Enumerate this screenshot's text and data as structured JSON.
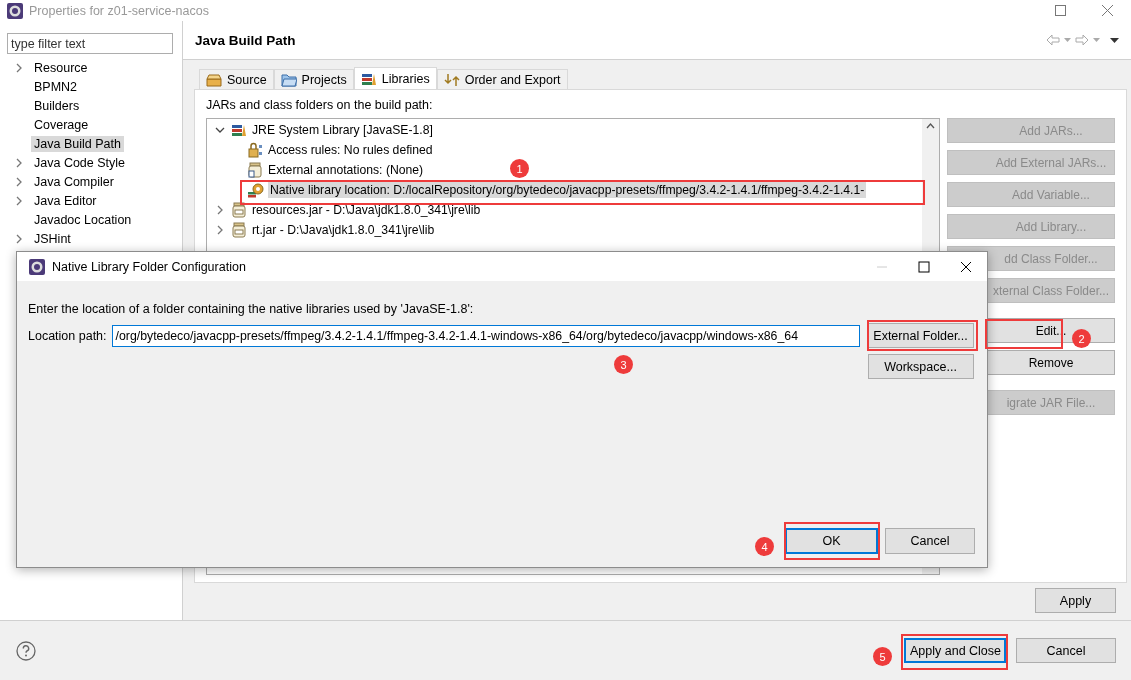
{
  "window": {
    "title": "Properties for z01-service-nacos"
  },
  "filter": {
    "placeholder": "type filter text"
  },
  "sidebar": {
    "items": [
      {
        "label": "Resource",
        "expandable": true,
        "selected": false
      },
      {
        "label": "BPMN2",
        "expandable": false,
        "selected": false
      },
      {
        "label": "Builders",
        "expandable": false,
        "selected": false
      },
      {
        "label": "Coverage",
        "expandable": false,
        "selected": false
      },
      {
        "label": "Java Build Path",
        "expandable": false,
        "selected": true
      },
      {
        "label": "Java Code Style",
        "expandable": true,
        "selected": false
      },
      {
        "label": "Java Compiler",
        "expandable": true,
        "selected": false
      },
      {
        "label": "Java Editor",
        "expandable": true,
        "selected": false
      },
      {
        "label": "Javadoc Location",
        "expandable": false,
        "selected": false
      },
      {
        "label": "JSHint",
        "expandable": true,
        "selected": false
      }
    ]
  },
  "page": {
    "title": "Java Build Path"
  },
  "tabs": [
    {
      "label": "Source",
      "kind": "source",
      "selected": false
    },
    {
      "label": "Projects",
      "kind": "projects",
      "selected": false
    },
    {
      "label": "Libraries",
      "kind": "libraries",
      "selected": true
    },
    {
      "label": "Order and Export",
      "kind": "order",
      "selected": false
    }
  ],
  "libraries": {
    "label": "JARs and class folders on the build path:",
    "tree": [
      {
        "label": "JRE System Library [JavaSE-1.8]",
        "kind": "library",
        "expanded": true,
        "selected": false,
        "children": [
          {
            "label": "Access rules: No rules defined",
            "kind": "rules",
            "selected": false
          },
          {
            "label": "External annotations: (None)",
            "kind": "annotations",
            "selected": false
          },
          {
            "label": "Native library location: D:/localRepository/org/bytedeco/javacpp-presets/ffmpeg/3.4.2-1.4.1/ffmpeg-3.4.2-1.4.1-",
            "kind": "native",
            "selected": true
          }
        ]
      },
      {
        "label": "resources.jar - D:\\Java\\jdk1.8.0_341\\jre\\lib",
        "kind": "jar",
        "expanded": false,
        "selected": false
      },
      {
        "label": "rt.jar - D:\\Java\\jdk1.8.0_341\\jre\\lib",
        "kind": "jar",
        "expanded": false,
        "selected": false
      }
    ],
    "buttons": [
      {
        "label": "Add JARs...",
        "disabled": true,
        "separated": false
      },
      {
        "label": "Add External JARs...",
        "disabled": true,
        "separated": false
      },
      {
        "label": "Add Variable...",
        "disabled": true,
        "separated": false
      },
      {
        "label": "Add Library...",
        "disabled": true,
        "separated": false
      },
      {
        "label": "dd Class Folder...",
        "disabled": true,
        "separated": false
      },
      {
        "label": "xternal Class Folder...",
        "disabled": true,
        "separated": false
      },
      {
        "label": "Edit...",
        "disabled": false,
        "separated": true
      },
      {
        "label": "Remove",
        "disabled": false,
        "separated": false
      },
      {
        "label": "igrate JAR File...",
        "disabled": true,
        "separated": true
      }
    ]
  },
  "apply": "Apply",
  "footer": {
    "buttons": [
      {
        "label": "Apply and Close",
        "default": true
      },
      {
        "label": "Cancel",
        "default": false
      }
    ]
  },
  "dialog": {
    "title": "Native Library Folder Configuration",
    "prompt": "Enter the location of a folder containing the native libraries used by 'JavaSE-1.8':",
    "location_label": "Location path:",
    "location_value": "/org/bytedeco/javacpp-presets/ffmpeg/3.4.2-1.4.1/ffmpeg-3.4.2-1.4.1-windows-x86_64/org/bytedeco/javacpp/windows-x86_64",
    "side_buttons": [
      "External Folder...",
      "Workspace..."
    ],
    "buttons": [
      {
        "label": "OK",
        "default": true
      },
      {
        "label": "Cancel",
        "default": false
      }
    ]
  },
  "annotations": [
    {
      "number": "1"
    },
    {
      "number": "2"
    },
    {
      "number": "3"
    },
    {
      "number": "4"
    },
    {
      "number": "5"
    }
  ]
}
